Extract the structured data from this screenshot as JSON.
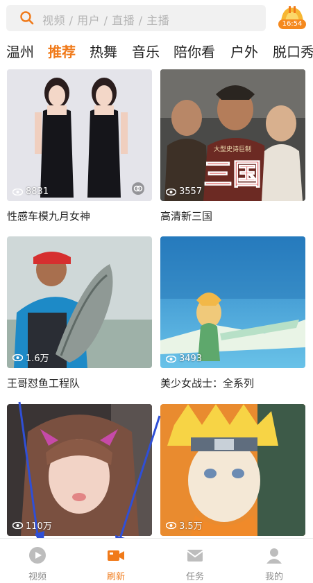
{
  "search": {
    "placeholder": "视频 / 用户 / 直播 / 主播",
    "badge_time": "16:54"
  },
  "tabs": [
    {
      "label": "温州",
      "active": false
    },
    {
      "label": "推荐",
      "active": true
    },
    {
      "label": "热舞",
      "active": false
    },
    {
      "label": "音乐",
      "active": false
    },
    {
      "label": "陪你看",
      "active": false
    },
    {
      "label": "户外",
      "active": false
    },
    {
      "label": "脱口秀",
      "active": false
    }
  ],
  "cards": [
    {
      "views": "8831",
      "title": "性感车模九月女神",
      "thumb_icon": "two-models-thumbnail"
    },
    {
      "views": "3557",
      "title": "高清新三国",
      "thumb_icon": "three-kingdoms-thumbnail",
      "overlay_small": "大型史诗巨制",
      "overlay_big": "三国"
    },
    {
      "views": "1.6万",
      "title": "王哥怼鱼工程队",
      "thumb_icon": "fisherman-thumbnail"
    },
    {
      "views": "3493",
      "title": "美少女战士：全系列",
      "thumb_icon": "anime-warrior-thumbnail"
    },
    {
      "views": "110万",
      "title": "",
      "thumb_icon": "girl-selfie-thumbnail"
    },
    {
      "views": "3.5万",
      "title": "",
      "thumb_icon": "naruto-thumbnail"
    }
  ],
  "bottom_nav": [
    {
      "label": "视频",
      "icon": "play-circle-icon",
      "active": false
    },
    {
      "label": "刷新",
      "icon": "video-camera-icon",
      "active": true
    },
    {
      "label": "任务",
      "icon": "envelope-icon",
      "active": false
    },
    {
      "label": "我的",
      "icon": "user-icon",
      "active": false
    }
  ],
  "colors": {
    "accent": "#f07a1a",
    "inactive": "#8a8a8a",
    "annotation_arrow": "#2f4fd6"
  }
}
